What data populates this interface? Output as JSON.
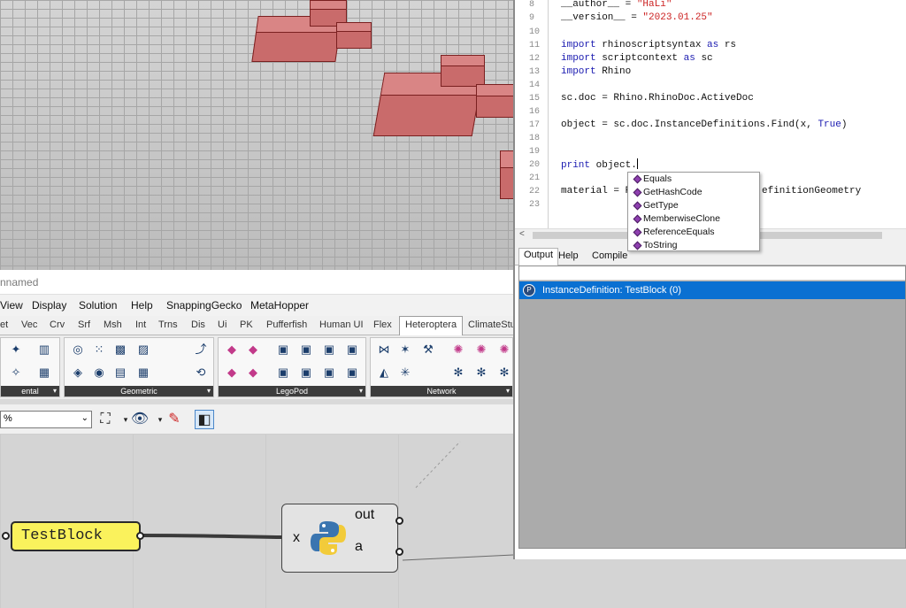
{
  "rhino_window": {
    "title": "nnamed"
  },
  "menu": [
    "View",
    "Display",
    "Solution",
    "Help",
    "SnappingGecko",
    "MetaHopper"
  ],
  "tabs": [
    "et",
    "Vec",
    "Crv",
    "Srf",
    "Msh",
    "Int",
    "Trns",
    "Dis",
    "Ui",
    "PK",
    "Pufferfish",
    "Human UI",
    "Flex",
    "Heteroptera",
    "ClimateStu"
  ],
  "active_tab": "Heteroptera",
  "ribbon_panels": [
    "ental",
    "Geometric",
    "LegoPod",
    "Network"
  ],
  "toolbar": {
    "zoom": "%"
  },
  "canvas": {
    "panel_text": "TestBlock",
    "component": {
      "input": "x",
      "outputs": [
        "out",
        "a"
      ]
    }
  },
  "editor": {
    "lines": [
      {
        "n": "8",
        "text": "__author__ = \"HaLi\""
      },
      {
        "n": "9",
        "text": "__version__ = \"2023.01.25\""
      },
      {
        "n": "10",
        "text": ""
      },
      {
        "n": "11",
        "text": "import rhinoscriptsyntax as rs"
      },
      {
        "n": "12",
        "text": "import scriptcontext as sc"
      },
      {
        "n": "13",
        "text": "import Rhino"
      },
      {
        "n": "14",
        "text": ""
      },
      {
        "n": "15",
        "text": "sc.doc = Rhino.RhinoDoc.ActiveDoc"
      },
      {
        "n": "16",
        "text": ""
      },
      {
        "n": "17",
        "text": "object = sc.doc.InstanceDefinitions.Find(x, True)"
      },
      {
        "n": "18",
        "text": ""
      },
      {
        "n": "19",
        "text": ""
      },
      {
        "n": "20",
        "text": "print object."
      },
      {
        "n": "21",
        "text": ""
      },
      {
        "n": "22",
        "text": "material = R"
      },
      {
        "n": "23",
        "text": ""
      }
    ],
    "line22_tail": "efinitionGeometry",
    "autocomplete": [
      "Equals",
      "GetHashCode",
      "GetType",
      "MemberwiseClone",
      "ReferenceEquals",
      "ToString"
    ],
    "output_tabs": [
      "Output",
      "Help",
      "Compile"
    ],
    "output_row": "InstanceDefinition: TestBlock (0)"
  },
  "colors": {
    "selection": "#0a70d2",
    "panel": "#faf25c",
    "box": "#c96b6b"
  }
}
